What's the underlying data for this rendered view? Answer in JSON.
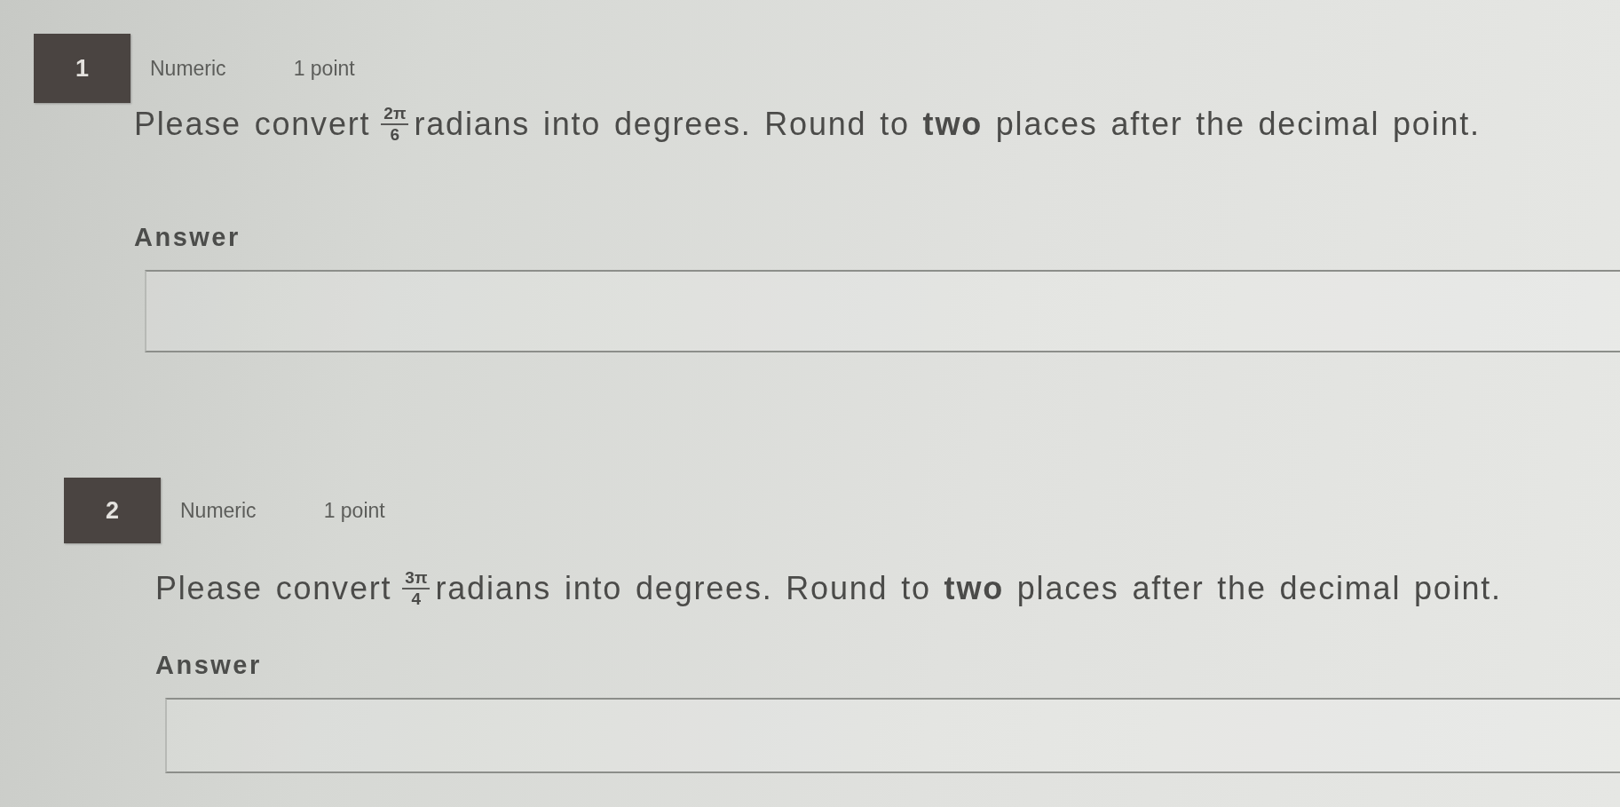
{
  "questions": [
    {
      "number": "1",
      "type": "Numeric",
      "points": "1 point",
      "prompt_before": "Please convert",
      "fraction": {
        "numerator": "2π",
        "denominator": "6"
      },
      "prompt_after": "radians into degrees. Round to **two** places after the decimal point.",
      "answer_label": "Answer"
    },
    {
      "number": "2",
      "type": "Numeric",
      "points": "1 point",
      "prompt_before": "Please convert",
      "fraction": {
        "numerator": "3π",
        "denominator": "4"
      },
      "prompt_after": "radians into degrees. Round to **two** places after the decimal point.",
      "answer_label": "Answer"
    }
  ]
}
